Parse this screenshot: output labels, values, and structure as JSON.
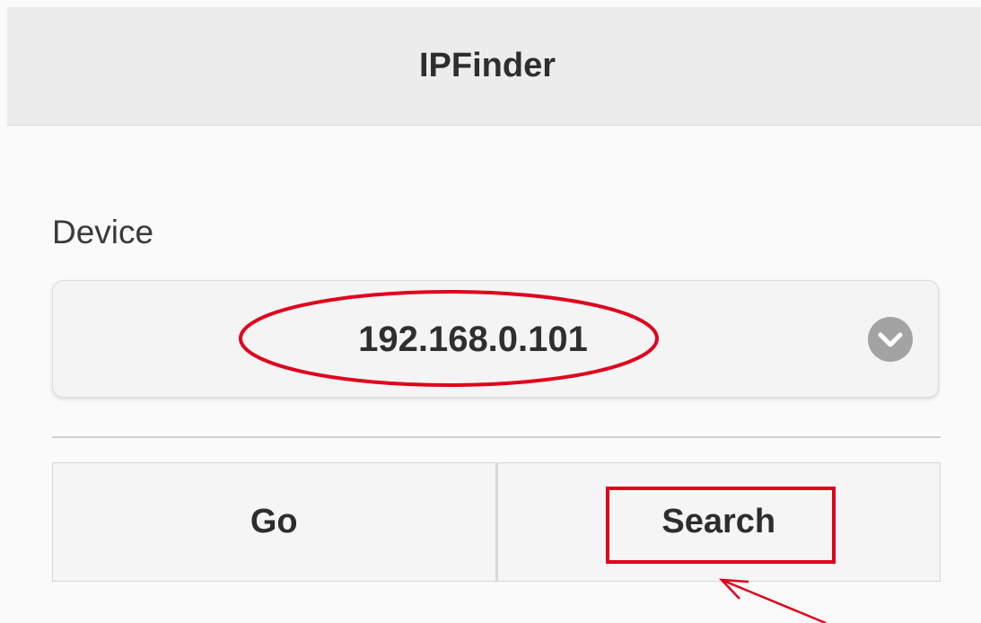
{
  "header": {
    "title": "IPFinder"
  },
  "device": {
    "label": "Device",
    "selected_value": "192.168.0.101",
    "dropdown_icon": "chevron-down-circle-icon"
  },
  "buttons": {
    "go_label": "Go",
    "search_label": "Search"
  },
  "colors": {
    "header_bg": "#ececec",
    "annotation_red": "#e0001b",
    "icon_gray": "#9e9e9e"
  }
}
